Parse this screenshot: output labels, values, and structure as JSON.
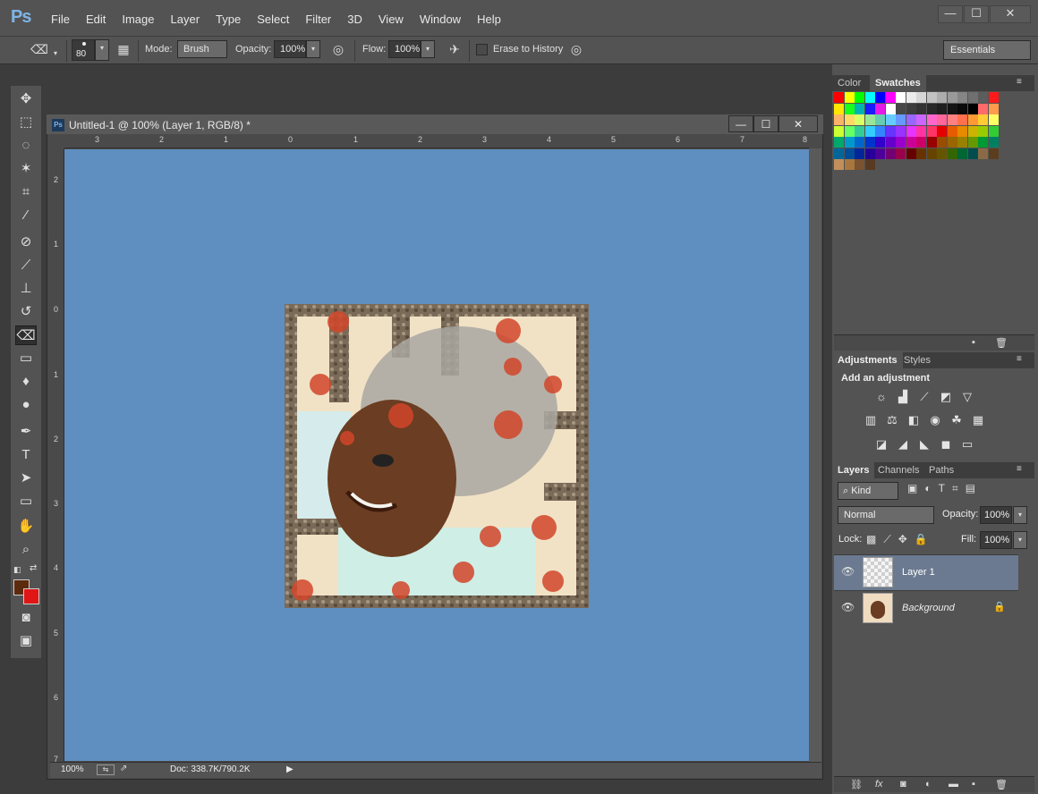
{
  "app": {
    "logo": "Ps",
    "menu": [
      "File",
      "Edit",
      "Image",
      "Layer",
      "Type",
      "Select",
      "Filter",
      "3D",
      "View",
      "Window",
      "Help"
    ],
    "window_controls": {
      "minimize": "—",
      "restore": "☐",
      "close": "✕"
    }
  },
  "options_bar": {
    "brush_size": "80",
    "mode_label": "Mode:",
    "mode_value": "Brush",
    "opacity_label": "Opacity:",
    "opacity_value": "100%",
    "flow_label": "Flow:",
    "flow_value": "100%",
    "erase_history_label": "Erase to History",
    "workspace": "Essentials"
  },
  "document": {
    "title": "Untitled-1 @ 100% (Layer 1, RGB/8) *",
    "zoom": "100%",
    "doc_size": "Doc: 338.7K/790.2K",
    "ruler_h": [
      "3",
      "2",
      "1",
      "0",
      "1",
      "2",
      "3",
      "4",
      "5",
      "6",
      "7",
      "8"
    ],
    "ruler_v": [
      "2",
      "1",
      "0",
      "1",
      "2",
      "3",
      "4",
      "5",
      "6",
      "7"
    ]
  },
  "colors": {
    "canvas_bg": "#5f8fc1",
    "foreground": "#5c2a0c",
    "background": "#e01616"
  },
  "panels": {
    "color_tab": "Color",
    "swatches_tab": "Swatches",
    "adjustments_tab": "Adjustments",
    "styles_tab": "Styles",
    "add_adjustment": "Add an adjustment",
    "layers_tab": "Layers",
    "channels_tab": "Channels",
    "paths_tab": "Paths",
    "kind_filter": "Kind",
    "blend_mode": "Normal",
    "opacity_label": "Opacity:",
    "opacity_value": "100%",
    "lock_label": "Lock:",
    "fill_label": "Fill:",
    "fill_value": "100%"
  },
  "layers": [
    {
      "name": "Layer 1",
      "selected": true
    },
    {
      "name": "Background",
      "selected": false
    }
  ]
}
